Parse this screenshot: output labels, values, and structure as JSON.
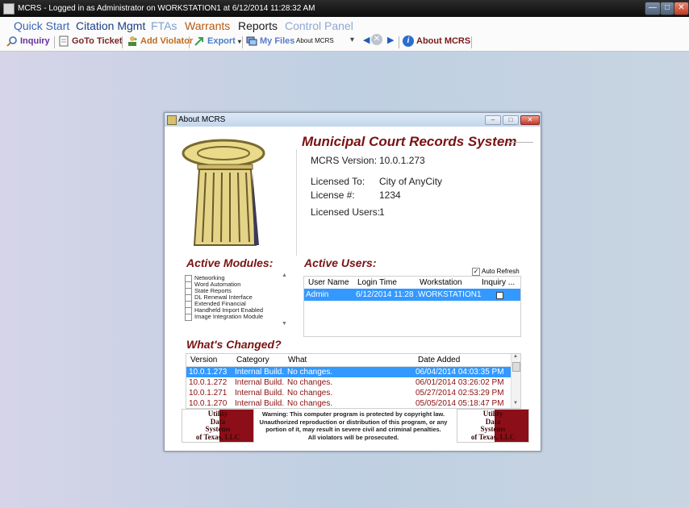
{
  "window": {
    "title": "MCRS - Logged in as Administrator on WORKSTATION1 at 6/12/2014 11:28:32 AM",
    "minimize_symbol": "—",
    "maximize_symbol": "□",
    "close_symbol": "✕"
  },
  "menu": {
    "items": [
      {
        "label": "Quick Start",
        "color": "#3a66b5"
      },
      {
        "label": "Citation Mgmt",
        "color": "#1a3f8a"
      },
      {
        "label": "FTAs",
        "color": "#7f9fcf"
      },
      {
        "label": "Warrants",
        "color": "#b85a10"
      },
      {
        "label": "Reports",
        "color": "#1a1a1a"
      },
      {
        "label": "Control Panel",
        "color": "#8fa8d2"
      }
    ]
  },
  "toolbar": {
    "inquiry": "Inquiry",
    "goto_ticket": "GoTo Ticket",
    "add_violator": "Add Violator",
    "export": "Export",
    "my_files": "My Files",
    "combo_value": "About MCRS",
    "about": "About MCRS"
  },
  "dialog": {
    "title": "About MCRS",
    "app_name": "Municipal Court Records System",
    "version_label": "MCRS Version:",
    "version_value": "10.0.1.273",
    "licensed_to_label": "Licensed To:",
    "licensed_to_value": "City of AnyCity",
    "license_no_label": "License #:",
    "license_no_value": "1234",
    "licensed_users_label": "Licensed Users:",
    "licensed_users_value": "1",
    "active_modules_title": "Active Modules:",
    "modules": [
      "Networking",
      "Word Automation",
      "State Reports",
      "DL Renewal Interface",
      "Extended Financial",
      "Handheld Import Enabled",
      "Image Integration Module"
    ],
    "active_users_title": "Active Users:",
    "auto_refresh_label": "Auto Refresh",
    "users_headers": [
      "User Name",
      "Login Time",
      "Workstation",
      "Inquiry ..."
    ],
    "users_rows": [
      {
        "user": "Admin",
        "login": "6/12/2014 11:28 ...",
        "workstation": "WORKSTATION1"
      }
    ],
    "whats_changed_title": "What's Changed?",
    "changes_headers": [
      "Version",
      "Category",
      "What",
      "Date Added"
    ],
    "changes_rows": [
      {
        "version": "10.0.1.273",
        "category": "Internal Build.",
        "what": "No changes.",
        "date": "06/04/2014 04:03:35 PM"
      },
      {
        "version": "10.0.1.272",
        "category": "Internal Build.",
        "what": "No changes.",
        "date": "06/01/2014 03:26:02 PM"
      },
      {
        "version": "10.0.1.271",
        "category": "Internal Build.",
        "what": "No changes.",
        "date": "05/27/2014 02:53:29 PM"
      },
      {
        "version": "10.0.1.270",
        "category": "Internal Build.",
        "what": "No changes.",
        "date": "05/05/2014 05:18:47 PM"
      }
    ],
    "warning_lines": [
      "Warning: This computer program is protected by copyright law.",
      "Unauthorized reproduction or distribution of this program, or any",
      "portion of it, may result in severe civil and criminal penalties.",
      "All violators will be prosecuted."
    ],
    "logo_lines": [
      "Utility",
      "Data",
      "Systems",
      "of Texas, LLC"
    ]
  },
  "colors": {
    "accent_red": "#7a1212",
    "selection_blue": "#3399ff",
    "row_text_red": "#8a1010"
  }
}
